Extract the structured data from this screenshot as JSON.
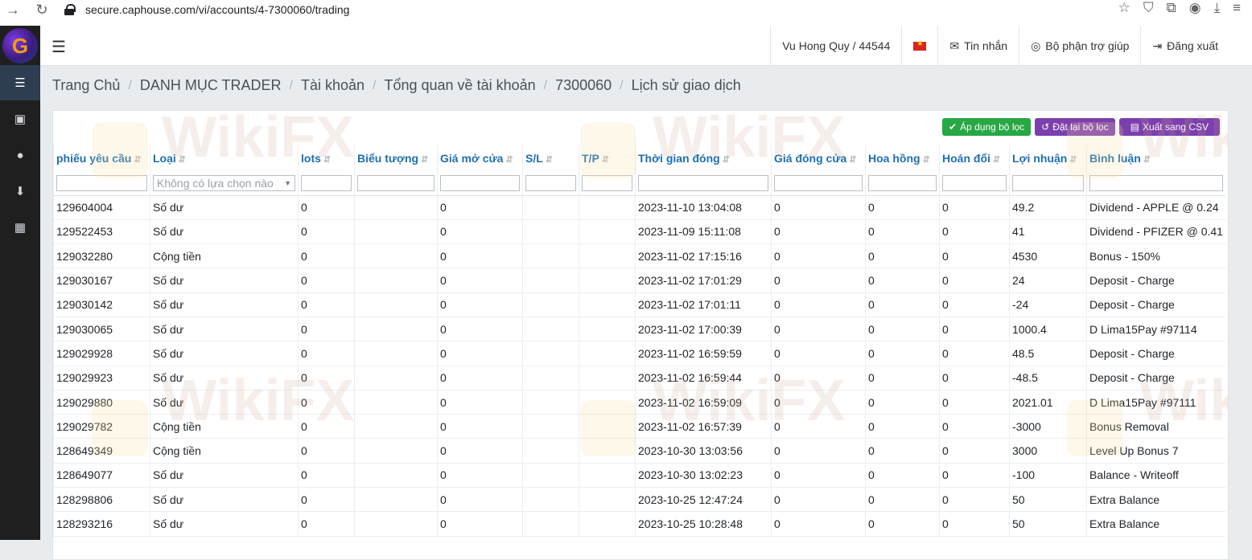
{
  "browser": {
    "url": "secure.caphouse.com/vi/accounts/4-7300060/trading",
    "back_icon": "arrow-right",
    "reload_icon": "reload"
  },
  "sidebar": {
    "logo_letter": "G",
    "items": [
      {
        "name": "list-icon",
        "glyph": "☰"
      },
      {
        "name": "wallet-icon",
        "glyph": "▣"
      },
      {
        "name": "user-icon",
        "glyph": "●"
      },
      {
        "name": "download-icon",
        "glyph": "⬇"
      },
      {
        "name": "calendar-icon",
        "glyph": "▦"
      }
    ]
  },
  "topnav": {
    "user": "Vu Hong Quy / 44544",
    "messages": "Tin nhắn",
    "support": "Bộ phận trợ giúp",
    "logout": "Đăng xuất"
  },
  "breadcrumb": [
    "Trang Chủ",
    "DANH MỤC TRADER",
    "Tài khoản",
    "Tổng quan về tài khoản",
    "7300060",
    "Lịch sử giao dịch"
  ],
  "toolbar": {
    "apply": "Áp dụng bộ lọc",
    "reset": "Đặt lại bộ lọc",
    "export": "Xuất sang CSV"
  },
  "filter": {
    "type_placeholder": "Không có lựa chọn nào"
  },
  "columns": [
    "phiếu yêu cầu",
    "Loại",
    "lots",
    "Biểu tượng",
    "Giá mở cửa",
    "S/L",
    "T/P",
    "Thời gian đóng",
    "Giá đóng cửa",
    "Hoa hồng",
    "Hoán đổi",
    "Lợi nhuận",
    "Bình luận"
  ],
  "rows": [
    [
      "129604004",
      "Số dư",
      "0",
      "",
      "0",
      "",
      "",
      "2023-11-10 13:04:08",
      "0",
      "0",
      "0",
      "49.2",
      "Dividend - APPLE @ 0.24"
    ],
    [
      "129522453",
      "Số dư",
      "0",
      "",
      "0",
      "",
      "",
      "2023-11-09 15:11:08",
      "0",
      "0",
      "0",
      "41",
      "Dividend - PFIZER @ 0.41"
    ],
    [
      "129032280",
      "Cộng tiền",
      "0",
      "",
      "0",
      "",
      "",
      "2023-11-02 17:15:16",
      "0",
      "0",
      "0",
      "4530",
      "Bonus - 150%"
    ],
    [
      "129030167",
      "Số dư",
      "0",
      "",
      "0",
      "",
      "",
      "2023-11-02 17:01:29",
      "0",
      "0",
      "0",
      "24",
      "Deposit - Charge"
    ],
    [
      "129030142",
      "Số dư",
      "0",
      "",
      "0",
      "",
      "",
      "2023-11-02 17:01:11",
      "0",
      "0",
      "0",
      "-24",
      "Deposit - Charge"
    ],
    [
      "129030065",
      "Số dư",
      "0",
      "",
      "0",
      "",
      "",
      "2023-11-02 17:00:39",
      "0",
      "0",
      "0",
      "1000.4",
      "D Lima15Pay #97114"
    ],
    [
      "129029928",
      "Số dư",
      "0",
      "",
      "0",
      "",
      "",
      "2023-11-02 16:59:59",
      "0",
      "0",
      "0",
      "48.5",
      "Deposit - Charge"
    ],
    [
      "129029923",
      "Số dư",
      "0",
      "",
      "0",
      "",
      "",
      "2023-11-02 16:59:44",
      "0",
      "0",
      "0",
      "-48.5",
      "Deposit - Charge"
    ],
    [
      "129029880",
      "Số dư",
      "0",
      "",
      "0",
      "",
      "",
      "2023-11-02 16:59:09",
      "0",
      "0",
      "0",
      "2021.01",
      "D Lima15Pay #97111"
    ],
    [
      "129029782",
      "Cộng tiền",
      "0",
      "",
      "0",
      "",
      "",
      "2023-11-02 16:57:39",
      "0",
      "0",
      "0",
      "-3000",
      "Bonus Removal"
    ],
    [
      "128649349",
      "Cộng tiền",
      "0",
      "",
      "0",
      "",
      "",
      "2023-10-30 13:03:56",
      "0",
      "0",
      "0",
      "3000",
      "Level Up Bonus 7"
    ],
    [
      "128649077",
      "Số dư",
      "0",
      "",
      "0",
      "",
      "",
      "2023-10-30 13:02:23",
      "0",
      "0",
      "0",
      "-100",
      "Balance - Writeoff"
    ],
    [
      "128298806",
      "Số dư",
      "0",
      "",
      "0",
      "",
      "",
      "2023-10-25 12:47:24",
      "0",
      "0",
      "0",
      "50",
      "Extra Balance"
    ],
    [
      "128293216",
      "Số dư",
      "0",
      "",
      "0",
      "",
      "",
      "2023-10-25 10:28:48",
      "0",
      "0",
      "0",
      "50",
      "Extra Balance"
    ]
  ],
  "watermark": "WikiFX",
  "colors": {
    "header_link": "#1f6fb2",
    "apply_button": "#28a745",
    "reset_button": "#7b3fae",
    "sidebar": "#1f1f1f"
  }
}
